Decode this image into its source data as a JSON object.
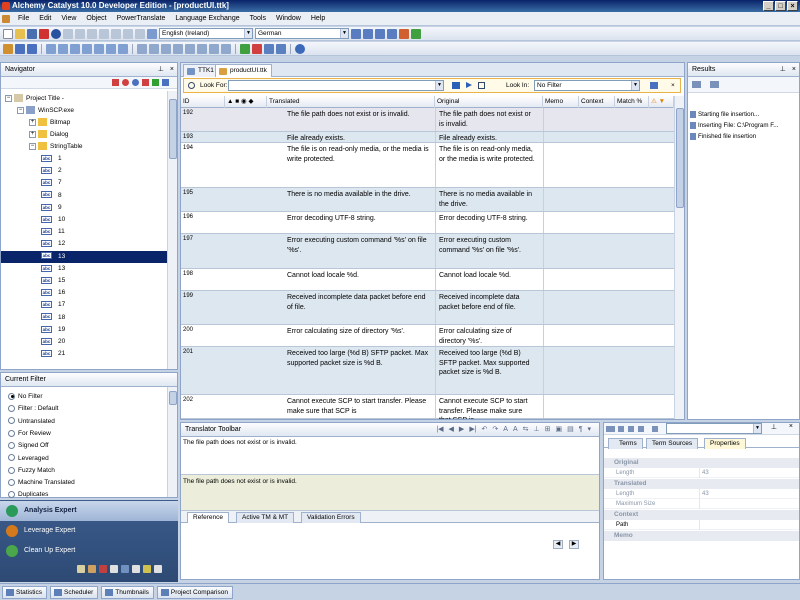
{
  "window": {
    "title": "Alchemy Catalyst 10.0 Developer Edition - [productUI.ttk]",
    "controls": [
      "_",
      "□",
      "×"
    ]
  },
  "menu": [
    "File",
    "Edit",
    "View",
    "Object",
    "PowerTranslate",
    "Language Exchange",
    "Tools",
    "Window",
    "Help"
  ],
  "toolbar": {
    "source_language": "English (Ireland)",
    "target_language": "German"
  },
  "navigator": {
    "title": "Navigator",
    "tree": [
      {
        "label": "Project Title -",
        "level": 0,
        "kind": "project"
      },
      {
        "label": "WinSCP.exe",
        "level": 1,
        "kind": "exe"
      },
      {
        "label": "Bitmap",
        "level": 2,
        "kind": "folder"
      },
      {
        "label": "Dialog",
        "level": 2,
        "kind": "folder"
      },
      {
        "label": "StringTable",
        "level": 2,
        "kind": "folder"
      }
    ],
    "strings": [
      "1",
      "2",
      "7",
      "8",
      "9",
      "10",
      "11",
      "12",
      "13",
      "13",
      "15",
      "16",
      "17",
      "18",
      "19",
      "20",
      "21"
    ],
    "selected_index": 8
  },
  "filter": {
    "title": "Current Filter",
    "items": [
      "No Filter",
      "Filter : Default",
      "Untranslated",
      "For Review",
      "Signed Off",
      "Leveraged",
      "Fuzzy Match",
      "Machine Translated",
      "Duplicates"
    ],
    "selected": 0
  },
  "experts": [
    {
      "label": "Analysis Expert",
      "color": "#2a9a5a"
    },
    {
      "label": "Leverage Expert",
      "color": "#d47a1c"
    },
    {
      "label": "Clean Up Expert",
      "color": "#4aa84a"
    }
  ],
  "editor": {
    "tabs": [
      "TTK1",
      "productUI.ttk"
    ],
    "find": {
      "look_for_label": "Look For:",
      "look_in_label": "Look In:",
      "look_in_value": "No Filter"
    },
    "columns": [
      "ID",
      "Translated",
      "Original",
      "Memo",
      "Context",
      "Match %"
    ],
    "rows": [
      {
        "id": "192",
        "translated": "The file path does not exist or is invalid.",
        "original": "The file path does not exist or is invalid."
      },
      {
        "id": "193",
        "translated": "File already exists.",
        "original": "File already exists."
      },
      {
        "id": "194",
        "translated": "The file is on read-only media, or the media is write protected.",
        "original": "The file is on read-only media, or the media is write protected."
      },
      {
        "id": "195",
        "translated": "There is no media available in the drive.",
        "original": "There is no media available in the drive."
      },
      {
        "id": "196",
        "translated": "Error decoding UTF-8 string.",
        "original": "Error decoding UTF-8 string."
      },
      {
        "id": "197",
        "translated": "Error executing custom command '%s' on file '%s'.",
        "original": "Error executing custom command '%s' on file '%s'."
      },
      {
        "id": "198",
        "translated": "Cannot load locale %d.",
        "original": "Cannot load locale %d."
      },
      {
        "id": "199",
        "translated": "Received incomplete data packet before end of file.",
        "original": "Received incomplete data packet before end of file."
      },
      {
        "id": "200",
        "translated": "Error calculating size of directory '%s'.",
        "original": "Error calculating size of directory '%s'."
      },
      {
        "id": "201",
        "translated": "Received too large (%d B) SFTP packet. Max supported packet size is %d B.",
        "original": "Received too large (%d B) SFTP packet. Max supported packet size is %d B."
      },
      {
        "id": "202",
        "translated": "Cannot execute SCP to start transfer. Please make sure that SCP is",
        "original": "Cannot execute SCP to start transfer. Please make sure that SCP is"
      }
    ]
  },
  "results": {
    "title": "Results",
    "items": [
      "Starting file insertion...",
      "Inserting File: C:\\Program F...",
      "Finished file insertion"
    ]
  },
  "translator": {
    "title": "Translator Toolbar",
    "translated_text": "The file path does not exist or is invalid.",
    "original_text": "The file path does not exist or is invalid.",
    "tabs": [
      "Reference",
      "Active TM & MT",
      "Validation Errors"
    ]
  },
  "properties": {
    "tabs": [
      "Terms",
      "Term Sources",
      "Properties"
    ],
    "categories": [
      {
        "name": "Original",
        "rows": [
          {
            "k": "Length",
            "v": "43"
          }
        ]
      },
      {
        "name": "Translated",
        "rows": [
          {
            "k": "Length",
            "v": "43"
          },
          {
            "k": "Maximum Size",
            "v": ""
          }
        ]
      },
      {
        "name": "Context",
        "rows": [
          {
            "k": "Path",
            "v": ""
          }
        ]
      },
      {
        "name": "Memo",
        "rows": []
      }
    ]
  },
  "statusbar": [
    "Statistics",
    "Scheduler",
    "Thumbnails",
    "Project Comparison"
  ]
}
